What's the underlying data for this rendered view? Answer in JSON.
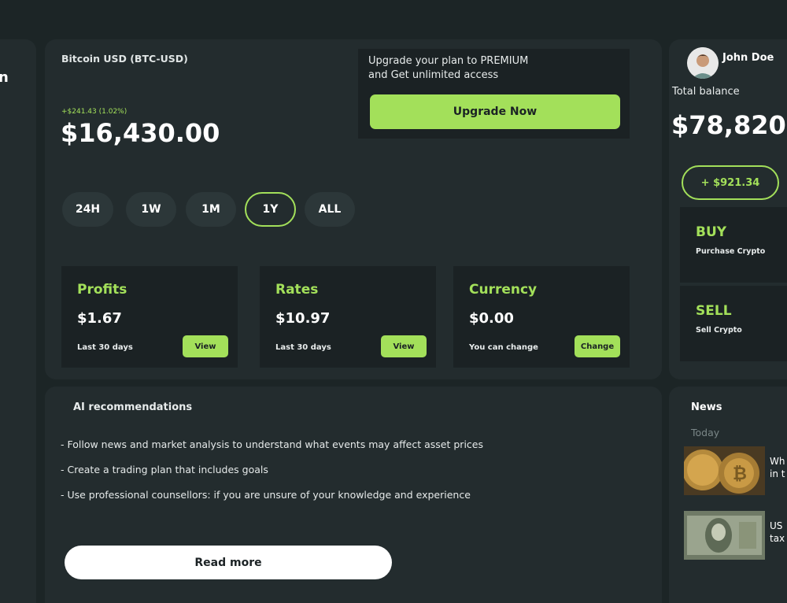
{
  "colors": {
    "accent": "#a3e05a",
    "background": "#1c2526",
    "panel": "#232c2e",
    "card": "#1b2224"
  },
  "sidebar": {
    "partial_text": "n"
  },
  "asset": {
    "name": "Bitcoin USD (BTC-USD)",
    "change": "+$241.43 (1.02%)",
    "price": "$16,430.00"
  },
  "timeframes": [
    {
      "label": "24H",
      "active": false
    },
    {
      "label": "1W",
      "active": false
    },
    {
      "label": "1M",
      "active": false
    },
    {
      "label": "1Y",
      "active": true
    },
    {
      "label": "ALL",
      "active": false
    }
  ],
  "upgrade": {
    "line1": "Upgrade your plan to PREMIUM",
    "line2": "and Get unlimited access",
    "button": "Upgrade Now"
  },
  "stats": [
    {
      "title": "Profits",
      "value": "$1.67",
      "sub": "Last 30 days",
      "button": "View"
    },
    {
      "title": "Rates",
      "value": "$10.97",
      "sub": "Last 30 days",
      "button": "View"
    },
    {
      "title": "Currency",
      "value": "$0.00",
      "sub": "You can change",
      "button": "Change"
    }
  ],
  "recommendations": {
    "title": "AI recommendations",
    "items": [
      "- Follow news and market analysis to understand what events may affect asset prices",
      "- Create a trading plan that includes goals",
      "- Use professional counsellors: if you are unsure of your knowledge and experience"
    ],
    "button": "Read more"
  },
  "user": {
    "name": "John Doe",
    "balance_label": "Total balance",
    "balance": "$78,820",
    "change": "+ $921.34"
  },
  "trade": [
    {
      "title": "BUY",
      "sub": "Purchase Crypto"
    },
    {
      "title": "SELL",
      "sub": "Sell Crypto"
    }
  ],
  "news": {
    "title": "News",
    "section": "Today",
    "items": [
      {
        "line1": "Wh",
        "line2": "in t"
      },
      {
        "line1": "US",
        "line2": "tax"
      }
    ]
  }
}
